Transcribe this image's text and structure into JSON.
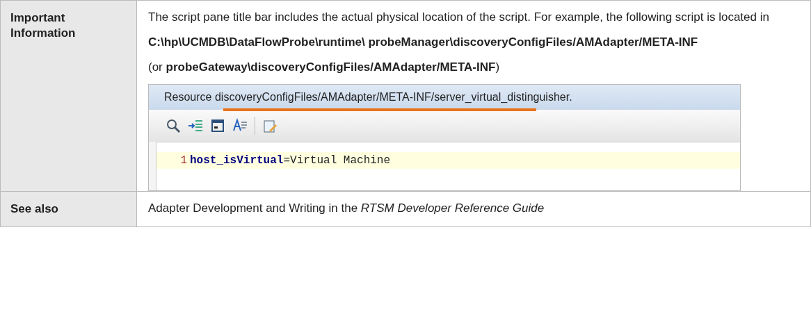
{
  "rows": [
    {
      "heading": "Important Information",
      "kind": "screenshot",
      "paragraphs": [
        "The script pane title bar includes the actual physical location of the script. For example, the following script is located in",
        "**C:\\hp\\UCMDB\\DataFlowProbe\\runtime\\ probeManager\\discoveryConfigFiles/AMAdapter/META-INF**",
        "(or **probeGateway\\discoveryConfigFiles/AMAdapter/META-INF**)"
      ],
      "screenshot": {
        "title": "Resource discoveryConfigFiles/AMAdapter/META-INF/server_virtual_distinguisher.",
        "lines": [
          {
            "number": "1",
            "key": "host_isVirtual",
            "value": "=Virtual Machine"
          }
        ]
      }
    },
    {
      "heading": "See also",
      "kind": "text",
      "paragraphs": [
        "Adapter Development and Writing in the *RTSM Developer Reference Guide*"
      ]
    }
  ]
}
